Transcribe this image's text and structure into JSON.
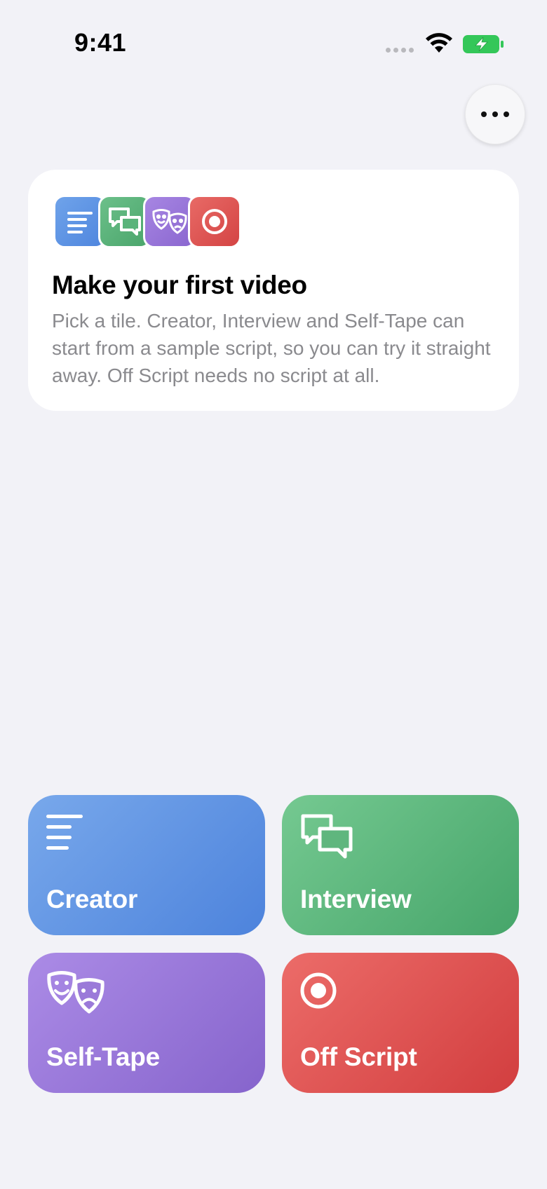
{
  "status_bar": {
    "time": "9:41"
  },
  "more_button": {
    "icon": "ellipsis-icon"
  },
  "intro_card": {
    "title": "Make your first video",
    "body": "Pick a tile. Creator, Interview and Self-Tape can start from a sample script, so you can try it straight away. Off Script needs no script at all.",
    "tile_icons": [
      "text-lines-icon",
      "speech-bubbles-icon",
      "theater-masks-icon",
      "record-icon"
    ]
  },
  "tiles": [
    {
      "label": "Creator",
      "icon": "text-lines-icon",
      "color": "#5B8EE3"
    },
    {
      "label": "Interview",
      "icon": "speech-bubbles-icon",
      "color": "#5AB47B"
    },
    {
      "label": "Self-Tape",
      "icon": "theater-masks-icon",
      "color": "#9673D6"
    },
    {
      "label": "Off Script",
      "icon": "record-icon",
      "color": "#DE5252"
    }
  ],
  "colors": {
    "background": "#F2F2F7",
    "battery": "#34C759"
  }
}
